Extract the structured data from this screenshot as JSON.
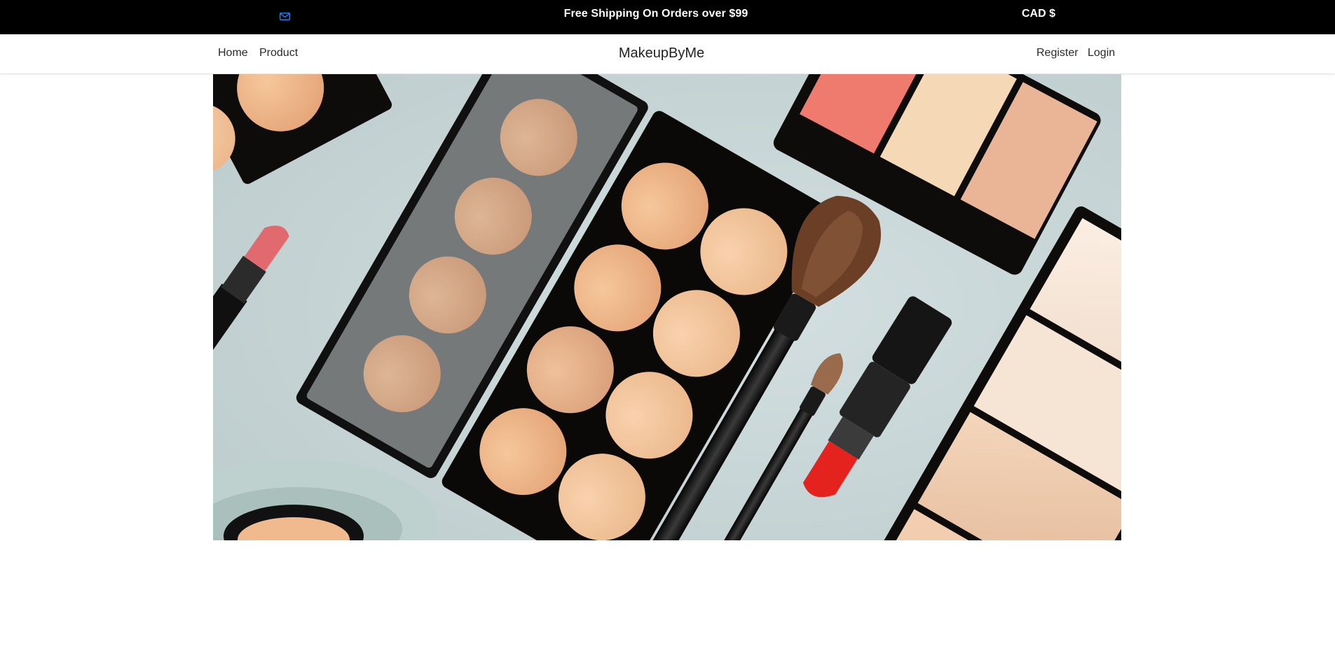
{
  "topbar": {
    "promo_text": "Free Shipping On Orders over $99",
    "currency_label": "CAD $",
    "mail_icon": "envelope-icon",
    "mail_icon_color": "#1e7bf0"
  },
  "navbar": {
    "links_left": [
      {
        "label": "Home"
      },
      {
        "label": "Product"
      }
    ],
    "brand": "MakeupByMe",
    "links_right": [
      {
        "label": "Register"
      },
      {
        "label": "Login"
      }
    ]
  },
  "hero": {
    "description_icon": "hero-image",
    "colors": {
      "background": "#cdd9da",
      "palette_case": "#0b0908",
      "lipstick_red": "#e4231f",
      "lipstick_pink": "#e06a6e",
      "blush": "#ef7a6e"
    }
  }
}
